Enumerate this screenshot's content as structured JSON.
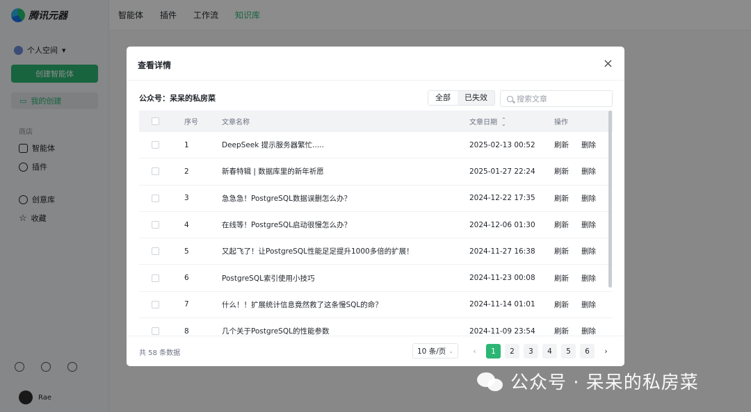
{
  "app": {
    "name": "腾讯元器"
  },
  "topnav": {
    "items": [
      "智能体",
      "插件",
      "工作流",
      "知识库"
    ],
    "active": "知识库"
  },
  "sidebar": {
    "space_label": "个人空间",
    "create_button": "创建智能体",
    "my_create": "我的创建",
    "store_section": "商店",
    "store_items": [
      "智能体",
      "插件"
    ],
    "other_items": [
      "创意库",
      "收藏"
    ],
    "user_name": "Rae"
  },
  "modal": {
    "title": "查看详情",
    "account_label": "公众号：呆呆的私房菜",
    "filter_tabs": [
      "全部",
      "已失效"
    ],
    "search_placeholder": "搜索文章",
    "columns": {
      "index": "序号",
      "name": "文章名称",
      "date": "文章日期",
      "op": "操作"
    },
    "rows": [
      {
        "no": "1",
        "name": "DeepSeek 提示服务器繁忙.....",
        "date": "2025-02-13 00:52"
      },
      {
        "no": "2",
        "name": "新春特辑 | 数据库里的新年祈愿",
        "date": "2025-01-27 22:24"
      },
      {
        "no": "3",
        "name": "急急急！PostgreSQL数据误删怎么办？",
        "date": "2024-12-22 17:35"
      },
      {
        "no": "4",
        "name": "在线等！PostgreSQL启动很慢怎么办？",
        "date": "2024-12-06 01:30"
      },
      {
        "no": "5",
        "name": "又起飞了！让PostgreSQL性能足足提升1000多倍的扩展！",
        "date": "2024-11-27 16:38"
      },
      {
        "no": "6",
        "name": "PostgreSQL索引使用小技巧",
        "date": "2024-11-23 00:08"
      },
      {
        "no": "7",
        "name": "什么！！扩展统计信息竟然救了这条慢SQL的命？",
        "date": "2024-11-14 01:01"
      },
      {
        "no": "8",
        "name": "几个关于PostgreSQL的性能参数",
        "date": "2024-11-09 23:54"
      }
    ],
    "row_actions": {
      "refresh": "刷新",
      "delete": "删除"
    },
    "total_text": "共 58 条数据",
    "page_size": "10 条/页",
    "pages": [
      "1",
      "2",
      "3",
      "4",
      "5",
      "6"
    ],
    "current_page": "1"
  },
  "watermark": {
    "text": "公众号 · 呆呆的私房菜"
  },
  "colors": {
    "accent": "#2bb673"
  }
}
